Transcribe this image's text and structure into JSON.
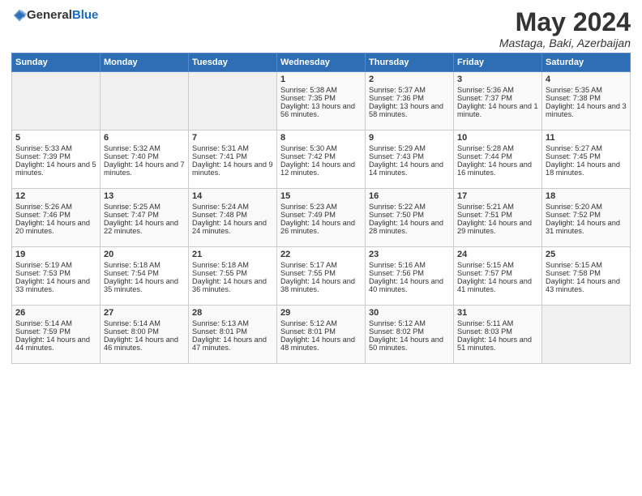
{
  "logo": {
    "general": "General",
    "blue": "Blue"
  },
  "title": "May 2024",
  "location": "Mastaga, Baki, Azerbaijan",
  "days_of_week": [
    "Sunday",
    "Monday",
    "Tuesday",
    "Wednesday",
    "Thursday",
    "Friday",
    "Saturday"
  ],
  "weeks": [
    [
      {
        "day": "",
        "sunrise": "",
        "sunset": "",
        "daylight": ""
      },
      {
        "day": "",
        "sunrise": "",
        "sunset": "",
        "daylight": ""
      },
      {
        "day": "",
        "sunrise": "",
        "sunset": "",
        "daylight": ""
      },
      {
        "day": "1",
        "sunrise": "Sunrise: 5:38 AM",
        "sunset": "Sunset: 7:35 PM",
        "daylight": "Daylight: 13 hours and 56 minutes."
      },
      {
        "day": "2",
        "sunrise": "Sunrise: 5:37 AM",
        "sunset": "Sunset: 7:36 PM",
        "daylight": "Daylight: 13 hours and 58 minutes."
      },
      {
        "day": "3",
        "sunrise": "Sunrise: 5:36 AM",
        "sunset": "Sunset: 7:37 PM",
        "daylight": "Daylight: 14 hours and 1 minute."
      },
      {
        "day": "4",
        "sunrise": "Sunrise: 5:35 AM",
        "sunset": "Sunset: 7:38 PM",
        "daylight": "Daylight: 14 hours and 3 minutes."
      }
    ],
    [
      {
        "day": "5",
        "sunrise": "Sunrise: 5:33 AM",
        "sunset": "Sunset: 7:39 PM",
        "daylight": "Daylight: 14 hours and 5 minutes."
      },
      {
        "day": "6",
        "sunrise": "Sunrise: 5:32 AM",
        "sunset": "Sunset: 7:40 PM",
        "daylight": "Daylight: 14 hours and 7 minutes."
      },
      {
        "day": "7",
        "sunrise": "Sunrise: 5:31 AM",
        "sunset": "Sunset: 7:41 PM",
        "daylight": "Daylight: 14 hours and 9 minutes."
      },
      {
        "day": "8",
        "sunrise": "Sunrise: 5:30 AM",
        "sunset": "Sunset: 7:42 PM",
        "daylight": "Daylight: 14 hours and 12 minutes."
      },
      {
        "day": "9",
        "sunrise": "Sunrise: 5:29 AM",
        "sunset": "Sunset: 7:43 PM",
        "daylight": "Daylight: 14 hours and 14 minutes."
      },
      {
        "day": "10",
        "sunrise": "Sunrise: 5:28 AM",
        "sunset": "Sunset: 7:44 PM",
        "daylight": "Daylight: 14 hours and 16 minutes."
      },
      {
        "day": "11",
        "sunrise": "Sunrise: 5:27 AM",
        "sunset": "Sunset: 7:45 PM",
        "daylight": "Daylight: 14 hours and 18 minutes."
      }
    ],
    [
      {
        "day": "12",
        "sunrise": "Sunrise: 5:26 AM",
        "sunset": "Sunset: 7:46 PM",
        "daylight": "Daylight: 14 hours and 20 minutes."
      },
      {
        "day": "13",
        "sunrise": "Sunrise: 5:25 AM",
        "sunset": "Sunset: 7:47 PM",
        "daylight": "Daylight: 14 hours and 22 minutes."
      },
      {
        "day": "14",
        "sunrise": "Sunrise: 5:24 AM",
        "sunset": "Sunset: 7:48 PM",
        "daylight": "Daylight: 14 hours and 24 minutes."
      },
      {
        "day": "15",
        "sunrise": "Sunrise: 5:23 AM",
        "sunset": "Sunset: 7:49 PM",
        "daylight": "Daylight: 14 hours and 26 minutes."
      },
      {
        "day": "16",
        "sunrise": "Sunrise: 5:22 AM",
        "sunset": "Sunset: 7:50 PM",
        "daylight": "Daylight: 14 hours and 28 minutes."
      },
      {
        "day": "17",
        "sunrise": "Sunrise: 5:21 AM",
        "sunset": "Sunset: 7:51 PM",
        "daylight": "Daylight: 14 hours and 29 minutes."
      },
      {
        "day": "18",
        "sunrise": "Sunrise: 5:20 AM",
        "sunset": "Sunset: 7:52 PM",
        "daylight": "Daylight: 14 hours and 31 minutes."
      }
    ],
    [
      {
        "day": "19",
        "sunrise": "Sunrise: 5:19 AM",
        "sunset": "Sunset: 7:53 PM",
        "daylight": "Daylight: 14 hours and 33 minutes."
      },
      {
        "day": "20",
        "sunrise": "Sunrise: 5:18 AM",
        "sunset": "Sunset: 7:54 PM",
        "daylight": "Daylight: 14 hours and 35 minutes."
      },
      {
        "day": "21",
        "sunrise": "Sunrise: 5:18 AM",
        "sunset": "Sunset: 7:55 PM",
        "daylight": "Daylight: 14 hours and 36 minutes."
      },
      {
        "day": "22",
        "sunrise": "Sunrise: 5:17 AM",
        "sunset": "Sunset: 7:55 PM",
        "daylight": "Daylight: 14 hours and 38 minutes."
      },
      {
        "day": "23",
        "sunrise": "Sunrise: 5:16 AM",
        "sunset": "Sunset: 7:56 PM",
        "daylight": "Daylight: 14 hours and 40 minutes."
      },
      {
        "day": "24",
        "sunrise": "Sunrise: 5:15 AM",
        "sunset": "Sunset: 7:57 PM",
        "daylight": "Daylight: 14 hours and 41 minutes."
      },
      {
        "day": "25",
        "sunrise": "Sunrise: 5:15 AM",
        "sunset": "Sunset: 7:58 PM",
        "daylight": "Daylight: 14 hours and 43 minutes."
      }
    ],
    [
      {
        "day": "26",
        "sunrise": "Sunrise: 5:14 AM",
        "sunset": "Sunset: 7:59 PM",
        "daylight": "Daylight: 14 hours and 44 minutes."
      },
      {
        "day": "27",
        "sunrise": "Sunrise: 5:14 AM",
        "sunset": "Sunset: 8:00 PM",
        "daylight": "Daylight: 14 hours and 46 minutes."
      },
      {
        "day": "28",
        "sunrise": "Sunrise: 5:13 AM",
        "sunset": "Sunset: 8:01 PM",
        "daylight": "Daylight: 14 hours and 47 minutes."
      },
      {
        "day": "29",
        "sunrise": "Sunrise: 5:12 AM",
        "sunset": "Sunset: 8:01 PM",
        "daylight": "Daylight: 14 hours and 48 minutes."
      },
      {
        "day": "30",
        "sunrise": "Sunrise: 5:12 AM",
        "sunset": "Sunset: 8:02 PM",
        "daylight": "Daylight: 14 hours and 50 minutes."
      },
      {
        "day": "31",
        "sunrise": "Sunrise: 5:11 AM",
        "sunset": "Sunset: 8:03 PM",
        "daylight": "Daylight: 14 hours and 51 minutes."
      },
      {
        "day": "",
        "sunrise": "",
        "sunset": "",
        "daylight": ""
      }
    ]
  ]
}
